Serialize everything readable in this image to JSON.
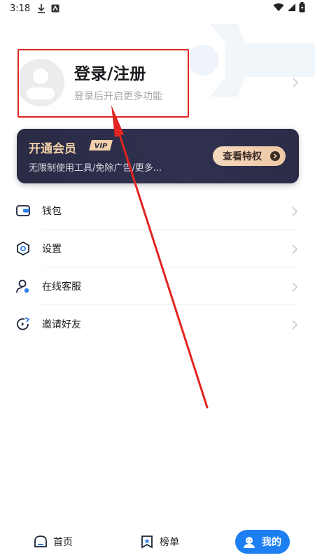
{
  "status_bar": {
    "time": "3:18",
    "icons": [
      "download-icon",
      "notification-app-icon",
      "wifi-icon",
      "signal-icon",
      "battery-icon"
    ]
  },
  "profile": {
    "title": "登录/注册",
    "subtitle": "登录后开启更多功能"
  },
  "vip": {
    "title": "开通会员",
    "badge": "VIP",
    "description": "无限制使用工具/免除广告/更多...",
    "button_label": "查看特权"
  },
  "menu": {
    "items": [
      {
        "label": "钱包",
        "icon": "wallet-icon"
      },
      {
        "label": "设置",
        "icon": "settings-icon"
      },
      {
        "label": "在线客服",
        "icon": "customer-service-icon"
      },
      {
        "label": "邀请好友",
        "icon": "invite-icon"
      }
    ]
  },
  "bottom_nav": {
    "items": [
      {
        "label": "首页",
        "icon": "home-icon",
        "active": false
      },
      {
        "label": "榜单",
        "icon": "ranking-icon",
        "active": false
      },
      {
        "label": "我的",
        "icon": "profile-icon",
        "active": true
      }
    ]
  },
  "colors": {
    "accent": "#1d7ff2",
    "vip_card": "#2c2d4a",
    "vip_gold": "#f2d0a9",
    "annotation": "#e02520"
  }
}
